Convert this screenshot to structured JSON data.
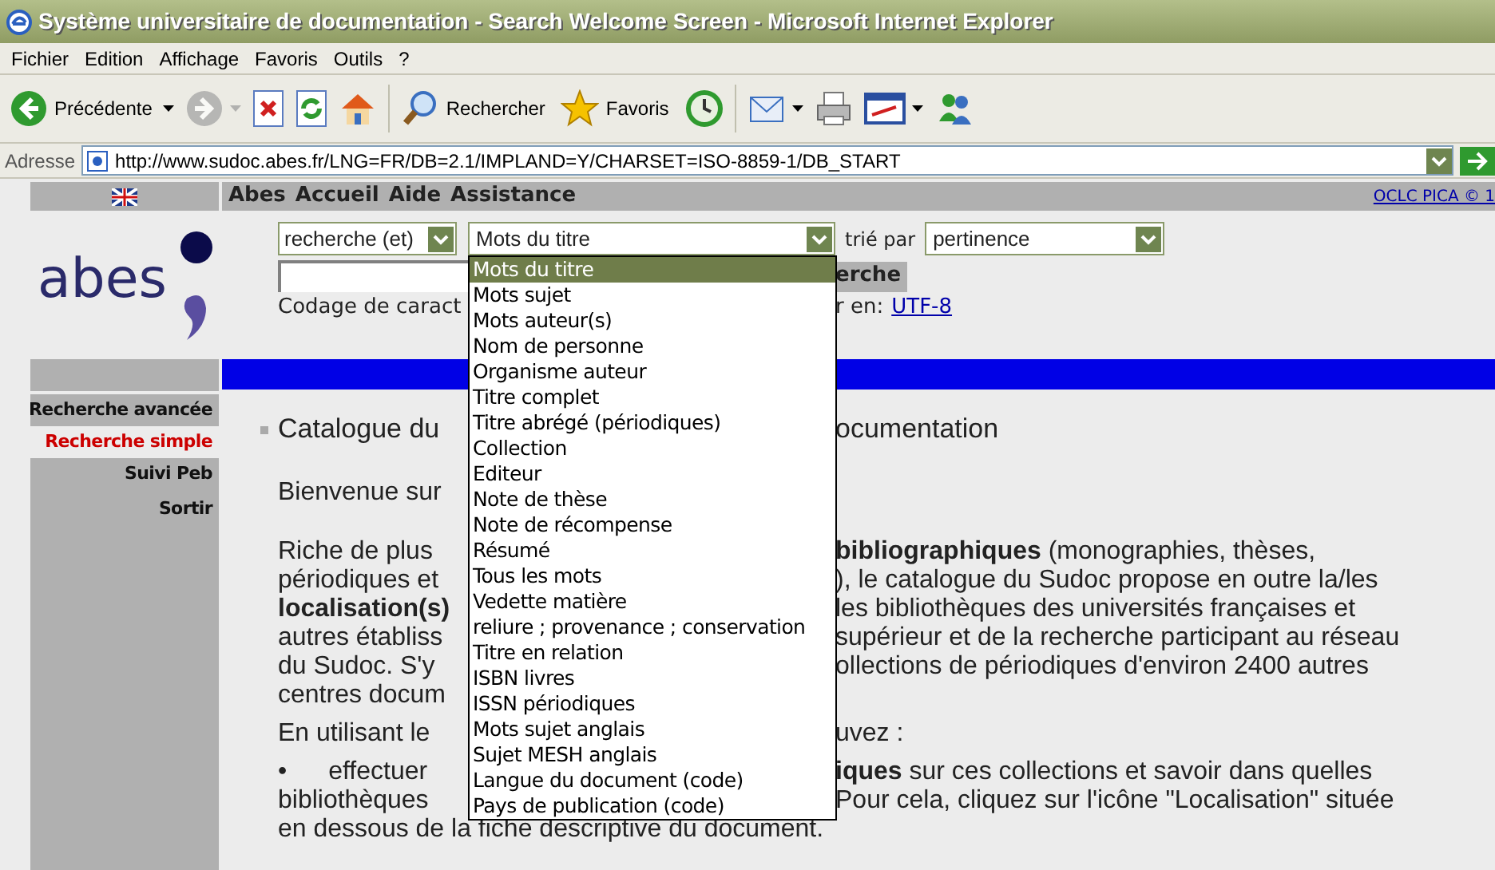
{
  "window": {
    "title": "Système universitaire de documentation - Search Welcome Screen - Microsoft Internet Explorer"
  },
  "menu": [
    "Fichier",
    "Edition",
    "Affichage",
    "Favoris",
    "Outils",
    "?"
  ],
  "toolbar": [
    {
      "kind": "back",
      "label": "Précédente",
      "dropdown": true,
      "disabled": false
    },
    {
      "kind": "forward",
      "dropdown": true,
      "disabled": true
    },
    {
      "kind": "stop",
      "dropdown": false,
      "disabled": false
    },
    {
      "kind": "refresh",
      "dropdown": false,
      "disabled": false
    },
    {
      "kind": "home",
      "dropdown": false,
      "disabled": false
    },
    {
      "kind": "search",
      "label": "Rechercher",
      "dropdown": false,
      "disabled": false
    },
    {
      "kind": "favorites",
      "label": "Favoris",
      "dropdown": false,
      "disabled": false
    },
    {
      "kind": "history",
      "dropdown": false,
      "disabled": false
    },
    {
      "kind": "mail",
      "dropdown": true,
      "disabled": false
    },
    {
      "kind": "print",
      "dropdown": false,
      "disabled": false
    },
    {
      "kind": "edit",
      "dropdown": true,
      "disabled": false
    },
    {
      "kind": "messenger",
      "dropdown": false,
      "disabled": false
    }
  ],
  "address_bar": {
    "label": "Adresse",
    "url": "http://www.sudoc.abes.fr/LNG=FR/DB=2.1/IMPLAND=Y/CHARSET=ISO-8859-1/DB_START"
  },
  "page": {
    "nav": [
      "Abes",
      "Accueil",
      "Aide",
      "Assistance"
    ],
    "copyright_link": "OCLC PICA © 1",
    "logo": "abes",
    "search": {
      "operator": "recherche (et)",
      "field": "Mots du titre",
      "sort_label": "trié par",
      "sort": "pertinence",
      "button": "erche",
      "encoding_label": "Codage de caract",
      "encoding_label_rest": "r en:",
      "encoding_link": "UTF-8"
    },
    "sidebar": [
      {
        "label": "Recherche avancée",
        "selected": false
      },
      {
        "label": "Recherche simple",
        "selected": true
      },
      {
        "label": "Suivi Peb",
        "selected": false
      },
      {
        "label": "Sortir",
        "selected": false
      }
    ],
    "paragraphs": [
      {
        "kind": "heading",
        "lines": [
          {
            "left": "Catalogue du",
            "bold": false,
            "right": "ocumentation"
          }
        ]
      },
      {
        "kind": "intro",
        "lines": [
          {
            "left": "Bienvenue sur",
            "bold": false
          }
        ]
      },
      {
        "kind": "text",
        "lines": [
          {
            "left": "Riche de plus",
            "bold": false,
            "right": "**bibliographiques** (monographies, thèses,"
          },
          {
            "left": "périodiques et",
            "bold": false,
            "right": "), le catalogue du Sudoc propose en outre la/les"
          },
          {
            "left": "localisation(s)",
            "bold": true,
            "right": "les bibliothèques des universités françaises et"
          },
          {
            "left": "autres établiss",
            "bold": false,
            "right": "supérieur et de la recherche participant au réseau"
          },
          {
            "left": "du Sudoc. S'y",
            "bold": false,
            "right": "ollections de périodiques d'environ 2400 autres"
          },
          {
            "left": "centres docum",
            "bold": false
          }
        ]
      },
      {
        "kind": "text",
        "lines": [
          {
            "left": "En utilisant le",
            "bold": false,
            "right": "uvez :"
          }
        ]
      },
      {
        "kind": "bullet",
        "bullet": "•",
        "lines": [
          {
            "left": "effectuer",
            "bold": false,
            "right": "**iques** sur ces collections et savoir dans quelles"
          },
          {
            "left": "bibliothèques",
            "bold": false,
            "right": "Pour cela, cliquez sur l'icône \"Localisation\" située"
          },
          {
            "full": "en dessous de la fiche descriptive du document."
          }
        ]
      }
    ],
    "dropdown": [
      {
        "label": "Mots du titre",
        "selected": true
      },
      {
        "label": "Mots sujet",
        "selected": false
      },
      {
        "label": "Mots auteur(s)",
        "selected": false
      },
      {
        "label": "Nom de personne",
        "selected": false
      },
      {
        "label": "Organisme auteur",
        "selected": false
      },
      {
        "label": "Titre complet",
        "selected": false
      },
      {
        "label": "Titre abrégé (périodiques)",
        "selected": false
      },
      {
        "label": "Collection",
        "selected": false
      },
      {
        "label": "Editeur",
        "selected": false
      },
      {
        "label": "Note de thèse",
        "selected": false
      },
      {
        "label": "Note de récompense",
        "selected": false
      },
      {
        "label": "Résumé",
        "selected": false
      },
      {
        "label": "Tous les mots",
        "selected": false
      },
      {
        "label": "Vedette matière",
        "selected": false
      },
      {
        "label": "reliure ; provenance ; conservation",
        "selected": false
      },
      {
        "label": "Titre en relation",
        "selected": false
      },
      {
        "label": "ISBN livres",
        "selected": false
      },
      {
        "label": "ISSN périodiques",
        "selected": false
      },
      {
        "label": "Mots sujet anglais",
        "selected": false
      },
      {
        "label": "Sujet MESH anglais",
        "selected": false
      },
      {
        "label": "Langue du document (code)",
        "selected": false
      },
      {
        "label": "Pays de publication (code)",
        "selected": false
      }
    ]
  }
}
